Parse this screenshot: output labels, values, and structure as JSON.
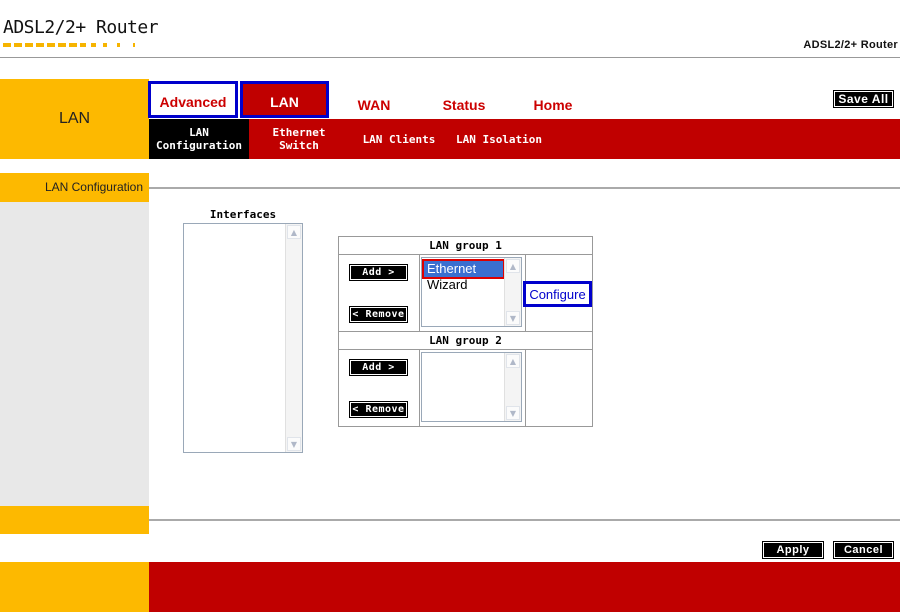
{
  "brand": {
    "logo_text": "ADSL2/2+ Router",
    "header_title": "ADSL2/2+ Router"
  },
  "colors": {
    "accent_yellow": "#fdb900",
    "accent_red": "#c00000",
    "highlight_blue": "#0000cc",
    "selection_blue": "#3a6fd0"
  },
  "sidebar": {
    "section_title": "LAN",
    "items": [
      {
        "label": "LAN Configuration"
      }
    ]
  },
  "tabs": [
    {
      "label": "Advanced"
    },
    {
      "label": "LAN",
      "active": true
    },
    {
      "label": "WAN"
    },
    {
      "label": "Status"
    },
    {
      "label": "Home"
    }
  ],
  "toolbar": {
    "save_all_label": "Save All"
  },
  "subtabs": [
    {
      "label": "LAN Configuration",
      "active": true
    },
    {
      "label": "Ethernet Switch"
    },
    {
      "label": "LAN Clients"
    },
    {
      "label": "LAN Isolation"
    }
  ],
  "interfaces": {
    "label": "Interfaces",
    "items": []
  },
  "groups": [
    {
      "title": "LAN group 1",
      "add_label": "Add >",
      "remove_label": "< Remove",
      "members": [
        "Ethernet",
        "Wizard"
      ],
      "selected": "Ethernet",
      "configure_label": "Configure"
    },
    {
      "title": "LAN group 2",
      "add_label": "Add >",
      "remove_label": "< Remove",
      "members": []
    }
  ],
  "actions": {
    "apply_label": "Apply",
    "cancel_label": "Cancel"
  },
  "icons": {
    "scroll_up": "scroll-up-arrow-icon",
    "scroll_down": "scroll-down-arrow-icon"
  }
}
